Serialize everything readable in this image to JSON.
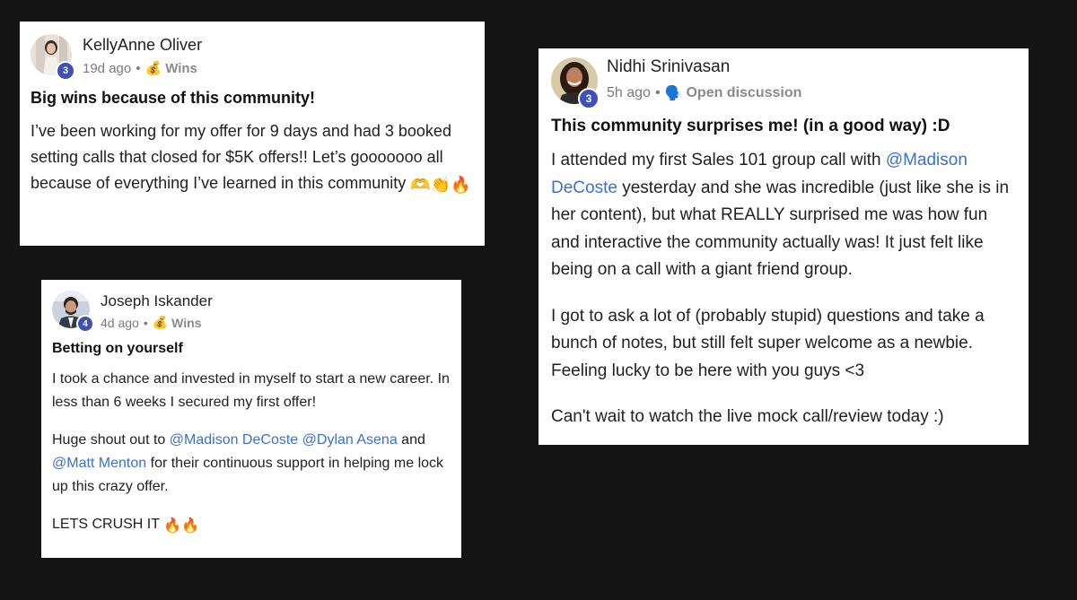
{
  "posts": [
    {
      "author": "KellyAnne Oliver",
      "level": "3",
      "time": "19d ago",
      "category_icon": "money-bag-icon",
      "category": "Wins",
      "title": "Big wins because of this community!",
      "paragraphs": [
        {
          "segments": [
            {
              "text": "I’ve been working for my offer for 9 days and had 3 booked setting calls that closed for $5K offers!! Let’s gooooooo all because of everything I’ve learned in this community "
            },
            {
              "emoji": "🫶👏🔥"
            }
          ]
        }
      ]
    },
    {
      "author": "Joseph Iskander",
      "level": "4",
      "time": "4d ago",
      "category_icon": "money-bag-icon",
      "category": "Wins",
      "title": "Betting on yourself",
      "paragraphs": [
        {
          "segments": [
            {
              "text": "I took a chance and invested in myself to start a new career. In less than 6 weeks I secured my first offer!"
            }
          ]
        },
        {
          "segments": [
            {
              "text": "Huge shout out to "
            },
            {
              "mention": "@Madison DeCoste"
            },
            {
              "text": " "
            },
            {
              "mention": "@Dylan Asena"
            },
            {
              "text": " and "
            },
            {
              "mention": "@Matt Menton"
            },
            {
              "text": " for their continuous support in helping me lock up this crazy offer."
            }
          ]
        },
        {
          "segments": [
            {
              "text": "LETS CRUSH IT "
            },
            {
              "emoji": "🔥🔥"
            }
          ]
        }
      ]
    },
    {
      "author": "Nidhi Srinivasan",
      "level": "3",
      "time": "5h ago",
      "category_icon": "speaking-head-icon",
      "category": "Open discussion",
      "title": "This community surprises me! (in a good way) :D",
      "paragraphs": [
        {
          "segments": [
            {
              "text": "I attended my first Sales 101 group call with "
            },
            {
              "mention": "@Madison DeCoste"
            },
            {
              "text": " yesterday and she was incredible (just like she is in her content), but what REALLY surprised me was how fun and interactive the community actually was! It just felt like being on a call with a giant friend group."
            }
          ]
        },
        {
          "segments": [
            {
              "text": "I got to ask a lot of (probably stupid) questions and take a bunch of notes, but still felt super welcome as a newbie. Feeling lucky to be here with you guys <3"
            }
          ]
        },
        {
          "segments": [
            {
              "text": "Can't wait to watch the live mock call/review today :)"
            }
          ]
        }
      ]
    }
  ],
  "colors": {
    "background": "#141414",
    "card": "#ffffff",
    "mention": "#3b6fd1",
    "level_badge": "#3f51b5",
    "meta": "#7a7a7a"
  }
}
